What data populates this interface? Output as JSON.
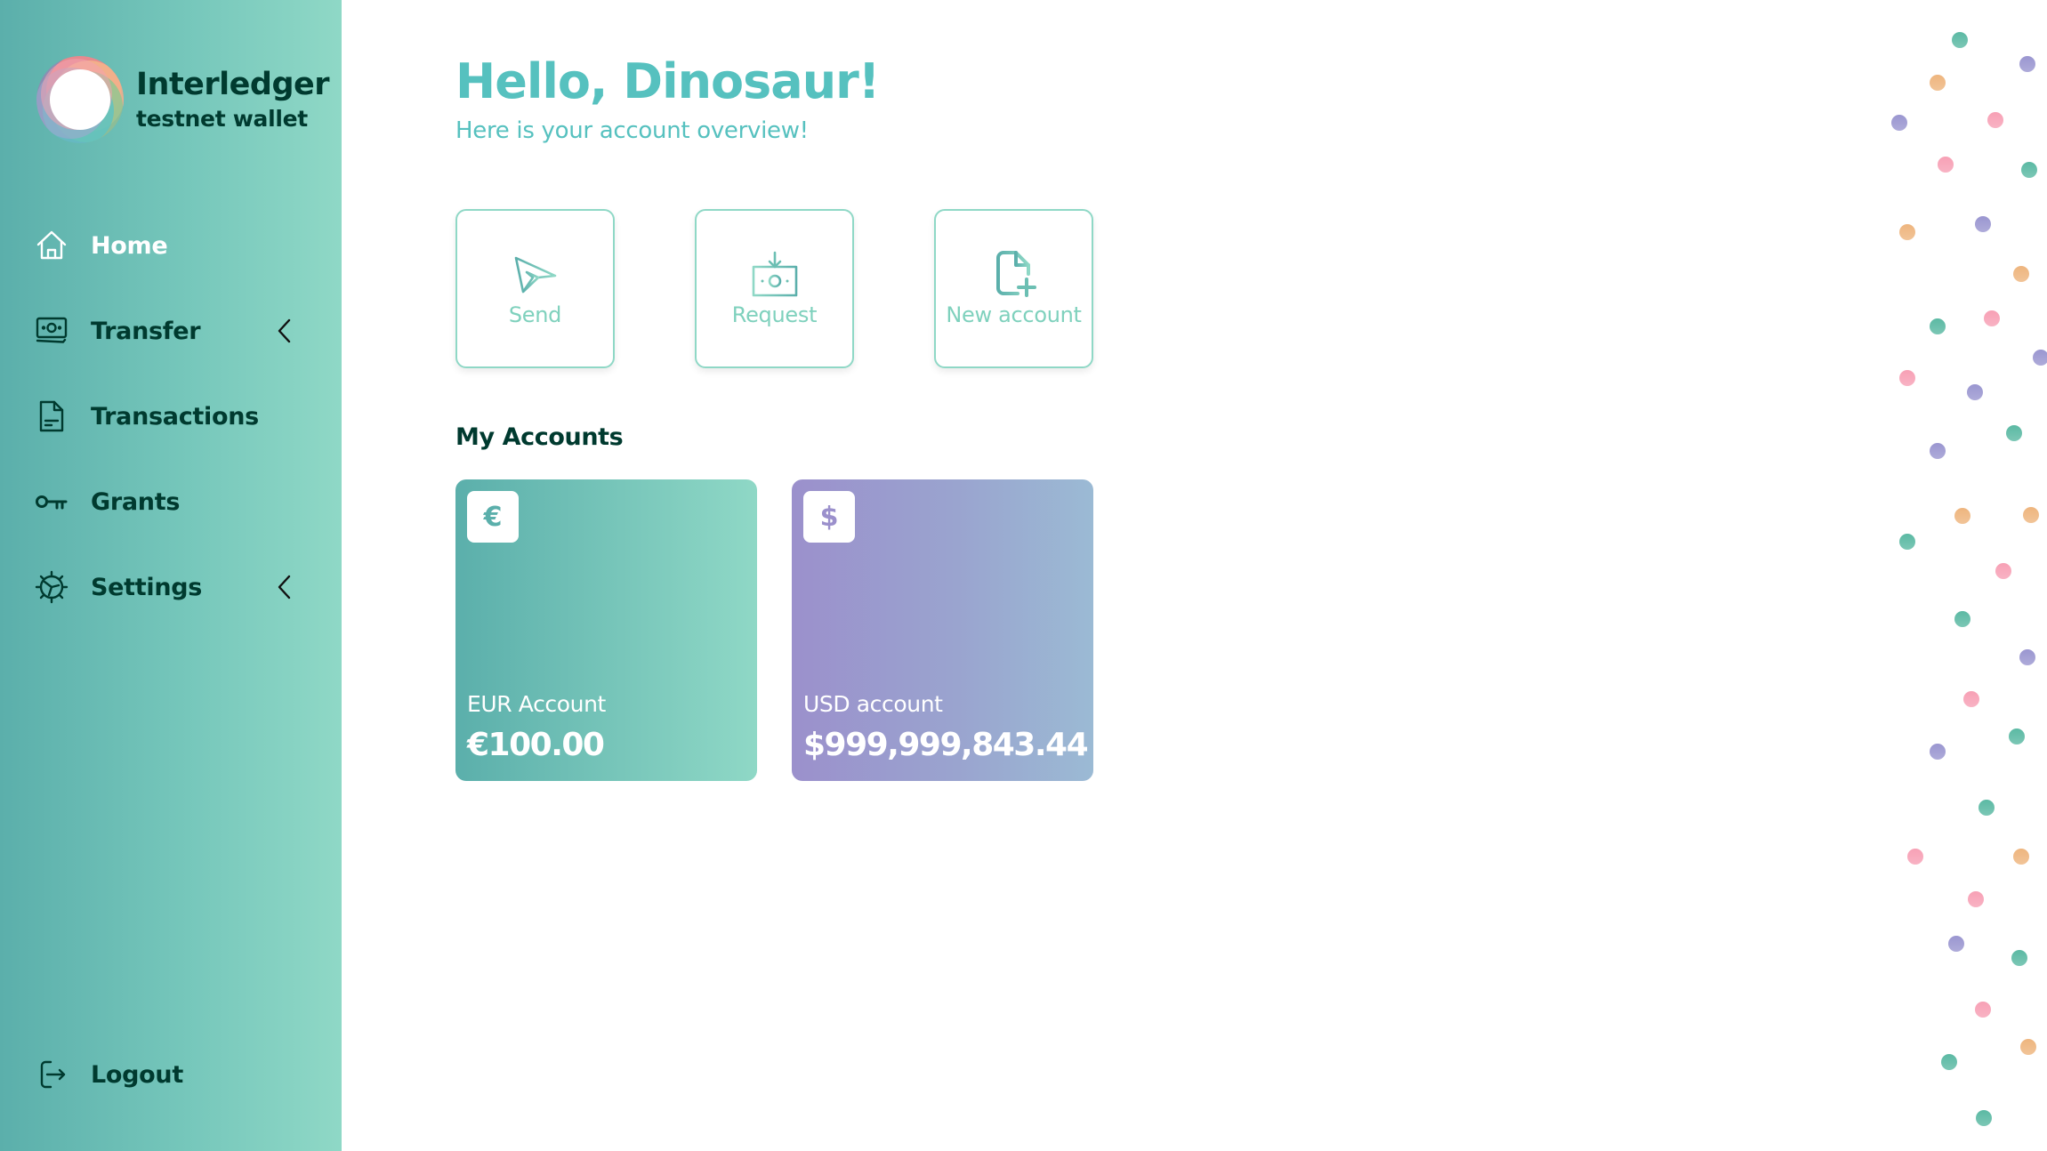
{
  "brand": {
    "title": "Interledger",
    "subtitle": "testnet wallet"
  },
  "nav": {
    "items": [
      {
        "label": "Home",
        "icon": "home-icon",
        "active": true,
        "expandable": false
      },
      {
        "label": "Transfer",
        "icon": "money-icon",
        "active": false,
        "expandable": true
      },
      {
        "label": "Transactions",
        "icon": "document-icon",
        "active": false,
        "expandable": false
      },
      {
        "label": "Grants",
        "icon": "key-icon",
        "active": false,
        "expandable": false
      },
      {
        "label": "Settings",
        "icon": "gear-icon",
        "active": false,
        "expandable": true
      }
    ],
    "logout": {
      "label": "Logout",
      "icon": "logout-icon"
    }
  },
  "main": {
    "greeting": "Hello, Dinosaur!",
    "subtitle": "Here is your account overview!",
    "actions": [
      {
        "label": "Send",
        "icon": "paper-plane-icon"
      },
      {
        "label": "Request",
        "icon": "request-money-icon"
      },
      {
        "label": "New account",
        "icon": "new-file-icon"
      }
    ],
    "accounts_title": "My Accounts",
    "accounts": [
      {
        "symbol": "€",
        "name": "EUR Account",
        "balance": "€100.00"
      },
      {
        "symbol": "$",
        "name": "USD account",
        "balance": "$999,999,843.44"
      }
    ]
  },
  "colors": {
    "primary_teal": "#56c1bf",
    "dark_green": "#003a2f",
    "light_teal": "#8fd8c6",
    "purple": "#9b90cc",
    "dot_teal": "#5bb9a3",
    "dot_purple": "#9a96d0",
    "dot_pink": "#f7a0b5",
    "dot_orange": "#eeb57e"
  }
}
